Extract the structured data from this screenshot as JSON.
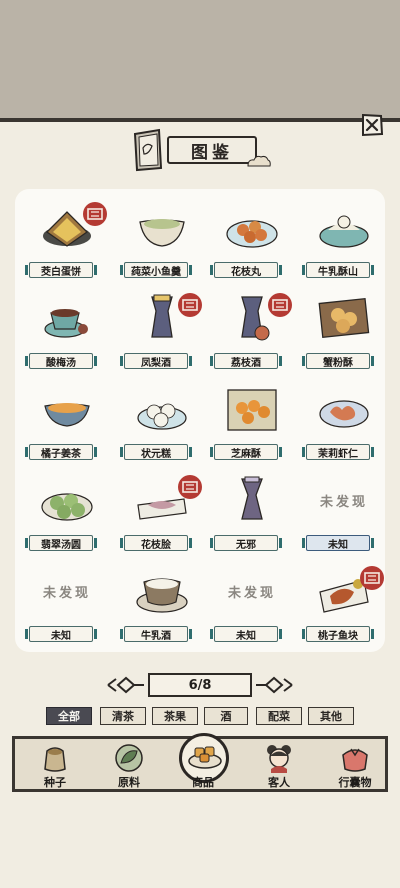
{
  "title": "图鉴",
  "items": [
    {
      "name": "茭白蛋饼",
      "stamp": true,
      "dish": "omelette"
    },
    {
      "name": "莼菜小鱼羹",
      "stamp": false,
      "dish": "soup-green"
    },
    {
      "name": "花枝丸",
      "stamp": false,
      "dish": "balls"
    },
    {
      "name": "牛乳酥山",
      "stamp": false,
      "dish": "bowl-teal"
    },
    {
      "name": "酸梅汤",
      "stamp": false,
      "dish": "plum-tea"
    },
    {
      "name": "凤梨酒",
      "stamp": true,
      "dish": "wine-vessel"
    },
    {
      "name": "荔枝酒",
      "stamp": true,
      "dish": "wine-vessel-lychee"
    },
    {
      "name": "蟹粉酥",
      "stamp": false,
      "dish": "pastry-tray"
    },
    {
      "name": "橘子姜茶",
      "stamp": false,
      "dish": "orange-tea"
    },
    {
      "name": "状元糕",
      "stamp": false,
      "dish": "white-cakes"
    },
    {
      "name": "芝麻酥",
      "stamp": false,
      "dish": "sesame-box"
    },
    {
      "name": "茉莉虾仁",
      "stamp": false,
      "dish": "shrimp"
    },
    {
      "name": "翡翠汤圆",
      "stamp": false,
      "dish": "green-balls"
    },
    {
      "name": "花枝脍",
      "stamp": true,
      "dish": "sashimi"
    },
    {
      "name": "无邪",
      "stamp": false,
      "dish": "purple-vessel"
    },
    {
      "name": "未知",
      "stamp": false,
      "undiscovered": true,
      "selected": true
    },
    {
      "name": "未知",
      "stamp": false,
      "undiscovered": true
    },
    {
      "name": "牛乳酒",
      "stamp": false,
      "dish": "milk-wine"
    },
    {
      "name": "未知",
      "stamp": false,
      "undiscovered": true
    },
    {
      "name": "桃子鱼块",
      "stamp": true,
      "dish": "fish"
    }
  ],
  "undiscovered_text": "未发现",
  "pager": {
    "text": "6/8"
  },
  "filters": [
    "全部",
    "清茶",
    "茶果",
    "酒",
    "配菜",
    "其他"
  ],
  "nav": [
    "种子",
    "原料",
    "商品",
    "客人",
    "行囊物"
  ],
  "colors": {
    "background": "#f1ede2",
    "label_border": "#4a6b6a",
    "stamp": "#b43a33",
    "selected_label": "#dee6ee"
  }
}
